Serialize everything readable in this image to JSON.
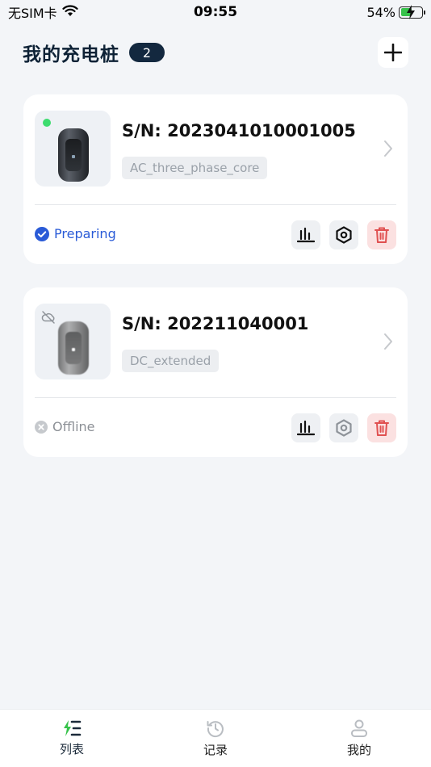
{
  "statusbar": {
    "carrier": "无SIM卡",
    "time": "09:55",
    "battery": "54%",
    "battery_level": 0.54
  },
  "header": {
    "title": "我的充电桩",
    "count": "2",
    "add_icon": "plus-icon"
  },
  "chargers": [
    {
      "sn": "S/N: 2023041010001005",
      "type": "AC_three_phase_core",
      "status": "Preparing",
      "status_icon": "check-circle-icon",
      "online": true
    },
    {
      "sn": "S/N: 202211040001",
      "type": "DC_extended",
      "status": "Offline",
      "status_icon": "x-circle-icon",
      "online": false
    }
  ],
  "tabs": [
    {
      "label": "列表",
      "icon": "list-bolt-icon",
      "active": true
    },
    {
      "label": "记录",
      "icon": "history-icon",
      "active": false
    },
    {
      "label": "我的",
      "icon": "user-icon",
      "active": false
    }
  ],
  "colors": {
    "accent_blue": "#2a5bd7",
    "online_green": "#3ddc6e",
    "danger_red": "#e05050",
    "badge_navy": "#13283f"
  }
}
